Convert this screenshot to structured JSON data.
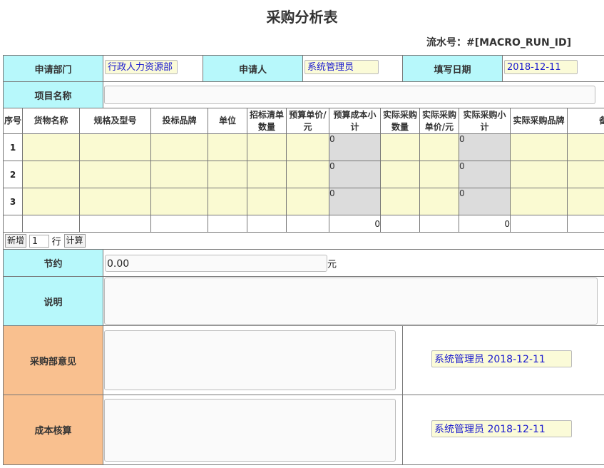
{
  "title": "采购分析表",
  "serial": "流水号：#[MACRO_RUN_ID]",
  "header": {
    "dept_label": "申请部门",
    "dept_value": "行政人力资源部",
    "applicant_label": "申请人",
    "applicant_value": "系统管理员",
    "date_label": "填写日期",
    "date_value": "2018-12-11"
  },
  "project": {
    "label": "项目名称",
    "value": ""
  },
  "grid": {
    "columns": [
      "序号",
      "货物名称",
      "规格及型号",
      "投标品牌",
      "单位",
      "招标清单数量",
      "预算单价/元",
      "预算成本小计",
      "实际采购数量",
      "实际采购单价/元",
      "实际采购小计",
      "实际采购品牌",
      "备注"
    ],
    "rows": [
      {
        "no": "1",
        "budget_subtotal": "0",
        "actual_subtotal": "0"
      },
      {
        "no": "2",
        "budget_subtotal": "0",
        "actual_subtotal": "0"
      },
      {
        "no": "3",
        "budget_subtotal": "0",
        "actual_subtotal": "0"
      }
    ],
    "total_budget": "0",
    "total_actual": "0"
  },
  "toolbar": {
    "add_label": "新增",
    "count_value": "1",
    "row_unit": "行",
    "calc_label": "计算"
  },
  "saving": {
    "label": "节约",
    "value": "0.00",
    "unit": "元"
  },
  "desc": {
    "label": "说明",
    "value": ""
  },
  "purchase_opinion": {
    "label": "采购部意见",
    "value": "",
    "sign": "系统管理员 2018-12-11"
  },
  "cost_check": {
    "label": "成本核算",
    "value": "",
    "sign": "系统管理员 2018-12-11"
  }
}
